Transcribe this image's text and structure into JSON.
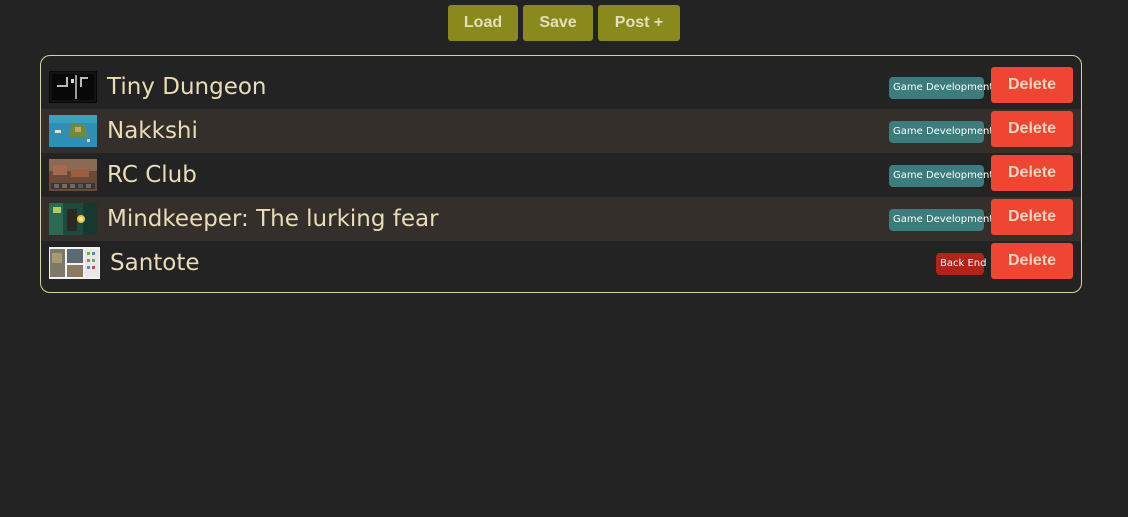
{
  "toolbar": {
    "load_label": "Load",
    "save_label": "Save",
    "post_label": "Post +"
  },
  "posts": [
    {
      "title": "Tiny Dungeon",
      "tag": "Game Development",
      "tag_color": "#3b7c7c",
      "delete_label": "Delete",
      "thumb": "dark-dungeon-thumbnail"
    },
    {
      "title": "Nakkshi",
      "tag": "Game Development",
      "tag_color": "#3b7c7c",
      "delete_label": "Delete",
      "thumb": "ocean-boat-thumbnail"
    },
    {
      "title": "RC Club",
      "tag": "Game Development",
      "tag_color": "#3b7c7c",
      "delete_label": "Delete",
      "thumb": "rc-car-thumbnail"
    },
    {
      "title": "Mindkeeper: The lurking fear",
      "tag": "Game Development",
      "tag_color": "#3b7c7c",
      "delete_label": "Delete",
      "thumb": "forest-lantern-thumbnail"
    },
    {
      "title": "Santote",
      "tag": "Back End",
      "tag_color": "#b32318",
      "delete_label": "Delete",
      "thumb": "collage-thumbnail"
    }
  ],
  "colors": {
    "background": "#232323",
    "toolbar_button": "#8a8a1c",
    "delete_button": "#f04530",
    "panel_border": "#d7cfa3",
    "row_alt": "#342f2b",
    "title_text": "#e9dcb6"
  }
}
